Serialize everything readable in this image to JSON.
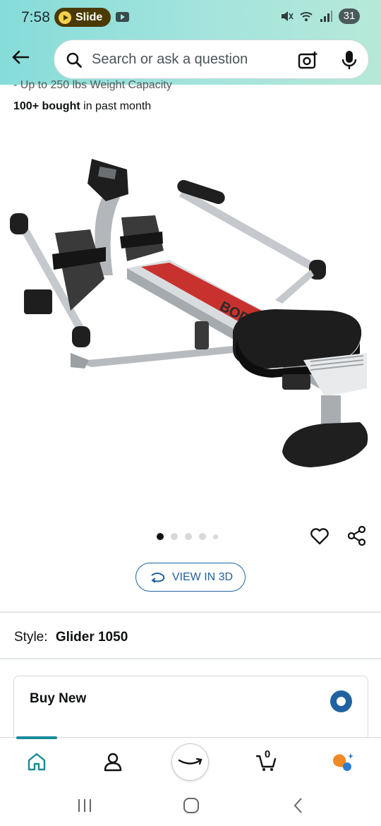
{
  "status_bar": {
    "time": "7:58",
    "slide_label": "Slide",
    "battery": "31"
  },
  "search": {
    "placeholder": "Search or ask a question"
  },
  "product": {
    "weight_capacity_partial": "- Up to 250 lbs Weight Capacity",
    "bought_bold": "100+ bought",
    "bought_rest": " in past month",
    "image_brand_text": "BODY",
    "image_count": 5,
    "active_image_index": 0
  },
  "actions": {
    "view_3d_label": "VIEW IN 3D"
  },
  "style": {
    "label": "Style:",
    "value": "Glider 1050"
  },
  "buy_card": {
    "title": "Buy New"
  },
  "bottom_nav": {
    "cart_count": "0"
  },
  "colors": {
    "header_teal": "#a4e4dd",
    "link_blue": "#2162a1",
    "text": "#0f1111"
  },
  "icons": [
    "back-arrow-icon",
    "search-icon",
    "camera-icon",
    "mic-icon",
    "heart-icon",
    "share-icon",
    "rotate-3d-icon",
    "home-icon",
    "account-icon",
    "amazon-smile-icon",
    "cart-icon",
    "rufus-icon"
  ]
}
